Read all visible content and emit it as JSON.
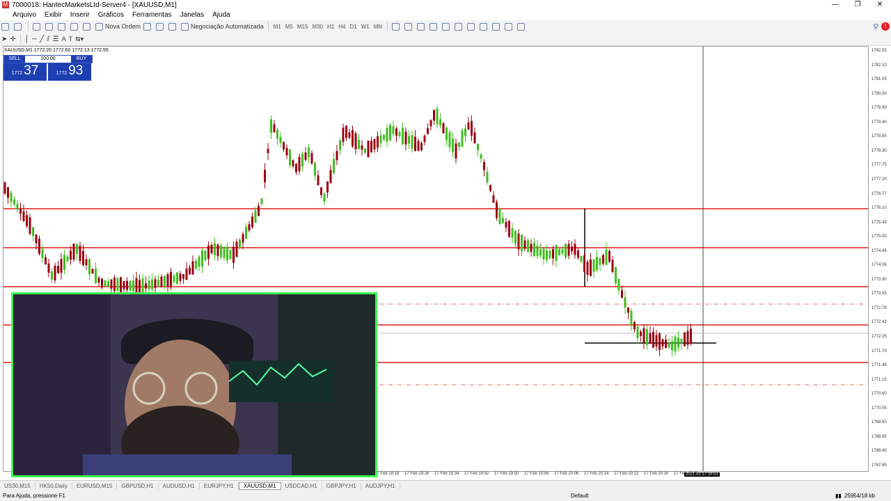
{
  "window": {
    "title": "7000018: HantecMarketsLtd-Server4 - [XAUUSD,M1]",
    "controls": [
      "—",
      "❐",
      "✕"
    ]
  },
  "menu": [
    "Arquivo",
    "Exibir",
    "Inserir",
    "Gráficos",
    "Ferramentas",
    "Janelas",
    "Ajuda"
  ],
  "toolbar": {
    "new_order": "Nova Ordem",
    "algo_trading": "Negociação Automatizada",
    "timeframes": [
      "M1",
      "M5",
      "M15",
      "M30",
      "H1",
      "H4",
      "D1",
      "W1",
      "MN"
    ]
  },
  "chart": {
    "symbol_info": "XAUUSD,M1  1772.20 1772.60 1772.13 1772.55",
    "sell_label": "SELL",
    "buy_label": "BUY",
    "lot": "100.00",
    "sell_price_small": "1772",
    "sell_price_big": "37",
    "buy_price_small": "1772",
    "buy_price_big": "93",
    "price_labels": [
      "1782.55",
      "1782.10",
      "1781.05",
      "1780.50",
      "1779.95",
      "1779.40",
      "1778.85",
      "1778.30",
      "1777.75",
      "1777.20",
      "1776.77",
      "1776.10",
      "1775.43",
      "1775.00",
      "1774.45",
      "1774.08",
      "1773.90",
      "1773.35",
      "1772.78",
      "1772.43",
      "1772.25",
      "1771.70",
      "1771.49",
      "1771.15",
      "1770.60",
      "1770.05",
      "1769.50",
      "1768.95",
      "1768.40",
      "1767.85"
    ],
    "time_labels": [
      "17 Feb 19:18",
      "17 Feb 19:26",
      "17 Feb 19:34",
      "17 Feb 19:42",
      "17 Feb 19:50",
      "17 Feb 19:58",
      "17 Feb 20:06",
      "17 Feb 20:14",
      "17 Feb 20:22",
      "17 Feb 20:30",
      "17 Feb 20:38"
    ],
    "crosshair_time": "2021.02.17 20:51"
  },
  "tabs": [
    "US30,M15",
    "HK50,Daily",
    "EURUSD,M15",
    "GBPUSD,H1",
    "AUDUSD,H1",
    "EURJPY,H1",
    "XAUUSD,M1",
    "USDCAD,H1",
    "GBPJPY,H1",
    "AUDJPY,H1"
  ],
  "active_tab": "XAUUSD,M1",
  "status": {
    "help": "Para Ajuda, pressione F1",
    "profile": "Default",
    "traffic": "25954/18 kb"
  }
}
